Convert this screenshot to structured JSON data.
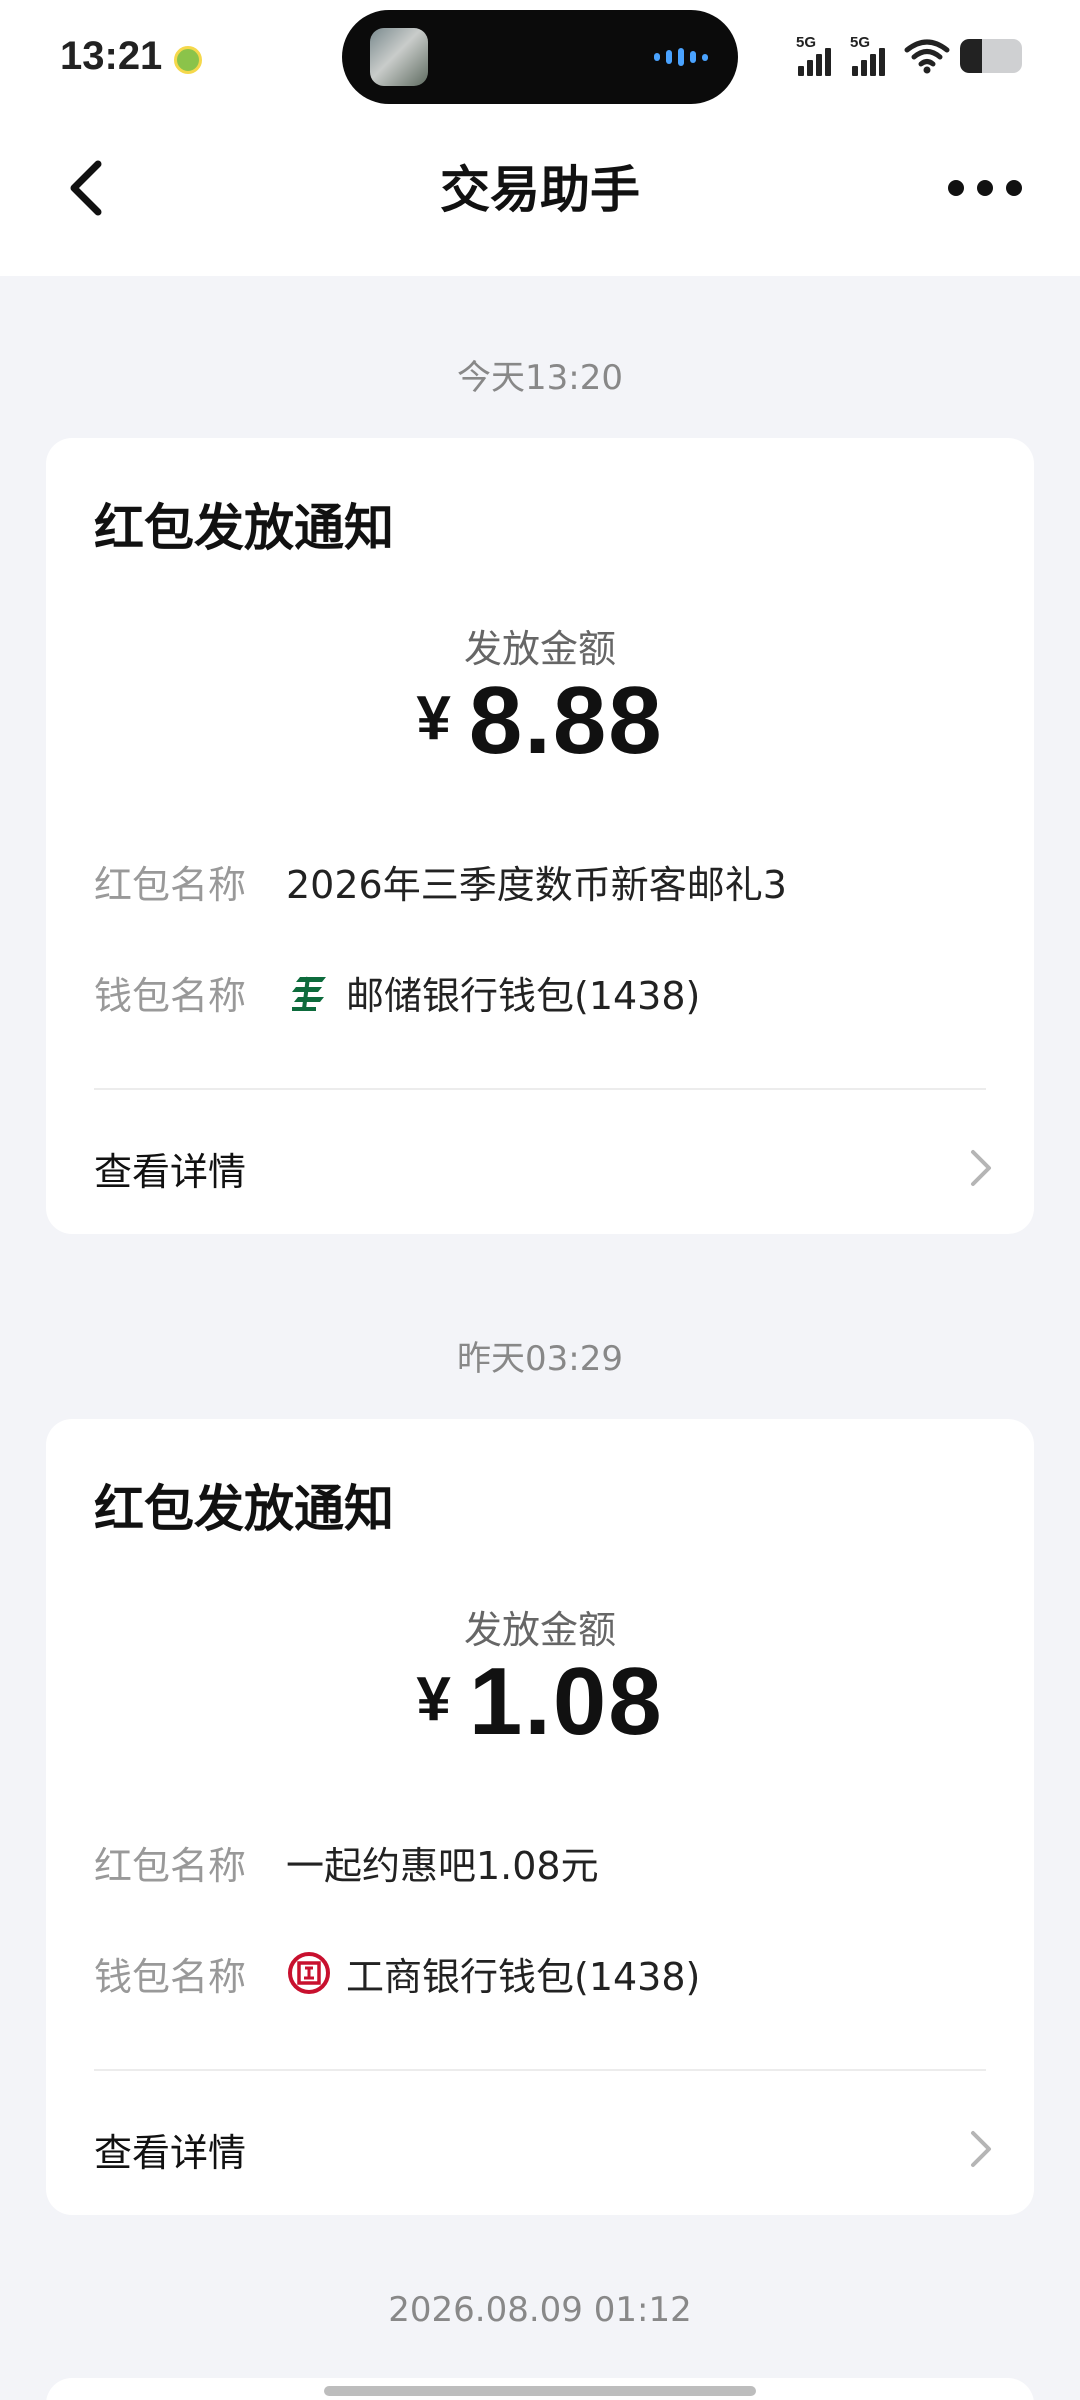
{
  "status_bar": {
    "time": "13:21",
    "signal_1_label": "5G",
    "signal_2_label": "5G",
    "battery_level": 0.35
  },
  "nav": {
    "title": "交易助手",
    "back_icon": "chevron-left-icon",
    "more_icon": "more-dots-icon"
  },
  "messages": [
    {
      "timestamp": "今天13:20",
      "title": "红包发放通知",
      "amount_label": "发放金额",
      "currency": "¥",
      "amount": "8.88",
      "name_key": "红包名称",
      "name_value": "2026年三季度数币新客邮礼3",
      "wallet_key": "钱包名称",
      "wallet_value": "邮储银行钱包(1438)",
      "wallet_icon": "postal-savings-bank-logo-icon",
      "detail_label": "查看详情"
    },
    {
      "timestamp": "昨天03:29",
      "title": "红包发放通知",
      "amount_label": "发放金额",
      "currency": "¥",
      "amount": "1.08",
      "name_key": "红包名称",
      "name_value": "一起约惠吧1.08元",
      "wallet_key": "钱包名称",
      "wallet_value": "工商银行钱包(1438)",
      "wallet_icon": "icbc-logo-icon",
      "detail_label": "查看详情"
    }
  ],
  "next_timestamp": "2026.08.09 01:12",
  "colors": {
    "background": "#f3f4f8",
    "card": "#ffffff",
    "postal_green": "#0d6b3c",
    "icbc_red": "#c8102e"
  }
}
